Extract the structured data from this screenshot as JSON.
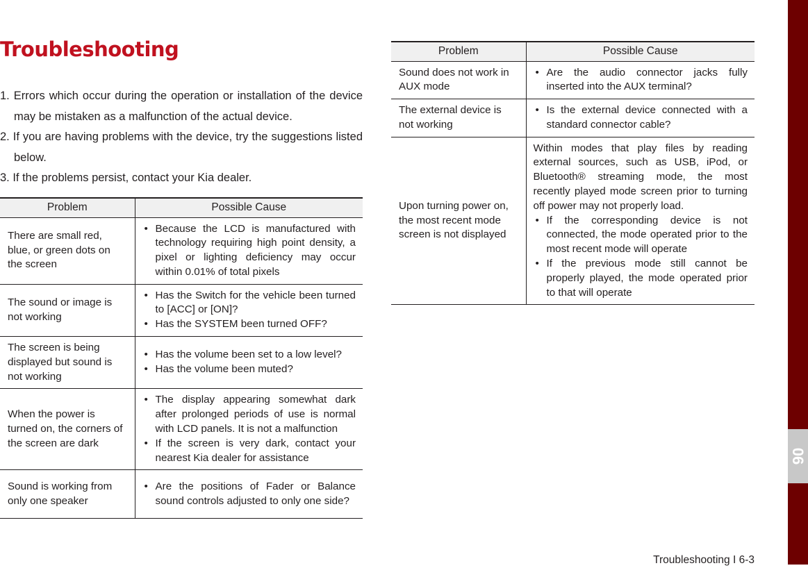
{
  "title": "Troubleshooting",
  "intro": [
    "1. Errors which occur during the operation or installation of the device may be mistaken as a malfunction of the actual device.",
    "2. If you are having problems with the device, try the suggestions listed below.",
    "3. If the problems persist, contact your Kia dealer."
  ],
  "headers": {
    "problem": "Problem",
    "cause": "Possible Cause"
  },
  "table1": [
    {
      "problem": "There are small red, blue, or green dots on the screen",
      "causes": [
        "Because the LCD is manufactured with technology requiring high point density, a pixel or lighting deficiency may occur within 0.01% of total pixels"
      ]
    },
    {
      "problem": "The sound or image is not working",
      "causes": [
        "Has the Switch for the vehicle been turned to [ACC] or [ON]?",
        "Has the SYSTEM been turned OFF?"
      ]
    },
    {
      "problem": "The screen is being displayed but sound is not working",
      "causes": [
        "Has the volume been set to a low level?",
        "Has the volume been muted?"
      ]
    },
    {
      "problem": "When the power is turned on, the corners of the screen are dark",
      "causes": [
        "The display appearing somewhat dark after prolonged periods of use is normal with LCD panels. It is not a malfunction",
        "If the screen is very dark, contact your nearest Kia dealer for assistance"
      ]
    },
    {
      "problem": "Sound is working from only one speaker",
      "causes": [
        "Are the positions of Fader or Balance sound controls adjusted to only one side?"
      ]
    }
  ],
  "table2": [
    {
      "problem": "Sound does not work in AUX mode",
      "causes": [
        "Are the audio connector jacks fully inserted into the AUX terminal?"
      ]
    },
    {
      "problem": "The external device is not working",
      "causes": [
        "Is the external device connected with a standard connector cable?"
      ]
    },
    {
      "problem": "Upon turning power on, the most recent mode screen is not displayed",
      "intro": "Within modes that play files by reading external sources, such as USB, iPod, or Bluetooth® streaming mode, the most recently played mode screen prior to turning off power may not properly load.",
      "causes": [
        "If the corresponding device is not connected, the mode operated prior to the most recent mode will operate",
        "If the previous mode still cannot be properly played, the mode operated prior to that will operate"
      ]
    }
  ],
  "chapter_tab": "06",
  "footer": "Troubleshooting I 6-3",
  "colors": {
    "title": "#c0111f",
    "side_bar": "#6d0000",
    "tab": "#c8c8c8"
  }
}
